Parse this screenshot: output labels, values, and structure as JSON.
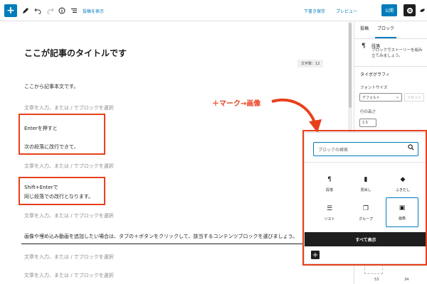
{
  "toolbar": {
    "add_icon": "+",
    "edit_icon": "pencil-icon",
    "undo_icon": "undo-icon",
    "redo_icon": "redo-icon",
    "info_icon": "info-icon",
    "list_icon": "list-view-icon",
    "show_block_link": "投稿を表示",
    "save_draft": "下書き保存",
    "preview": "プレビュー",
    "publish": "公開",
    "settings_icon": "gear-icon",
    "jetpack_icon": "jetpack-icon"
  },
  "editor": {
    "title": "ここが記事のタイトルです",
    "word_count": "文字数：12",
    "paragraphs": {
      "p1": "ここから記事本文です。",
      "placeholder": "文章を入力、または / でブロックを選択",
      "enter_a": "Enterを押すと",
      "enter_b": "次の段落に改行できて、",
      "shift_a": "Shift+Enterで",
      "shift_b": "同じ段落での改行となります。",
      "long": "画像や埋め込み動画を追加したい場合は、タブの＋ボタンをクリックして、該当するコンテンツブロックを選びましょう。"
    }
  },
  "annotation": {
    "text": "＋マーク→画像",
    "color": "#e8401c"
  },
  "sidebar": {
    "tab_post": "投稿",
    "tab_block": "ブロック",
    "block_title": "段落",
    "block_desc": "ブロックでストーリーを組み立てみましょう。",
    "typography": "タイポグラフィ",
    "font_size_label": "フォントサイズ",
    "font_size_value": "デフォルト",
    "reset": "リセット",
    "line_height_label": "行の高さ",
    "line_height_value": "1.5",
    "num_a": "53",
    "num_b": "34"
  },
  "inserter": {
    "search_placeholder": "ブロックの検索",
    "blocks": [
      {
        "label": "段落",
        "icon": "¶"
      },
      {
        "label": "見出し",
        "icon": "▮"
      },
      {
        "label": "ふきだし",
        "icon": "◆"
      },
      {
        "label": "リスト",
        "icon": "☰"
      },
      {
        "label": "グループ",
        "icon": "❐"
      },
      {
        "label": "画像",
        "icon": "▣"
      }
    ],
    "show_all": "すべて表示",
    "add_icon": "+"
  },
  "colors": {
    "accent": "#007cba",
    "annotation_red": "#e8401c",
    "dark": "#1e1e1e"
  }
}
